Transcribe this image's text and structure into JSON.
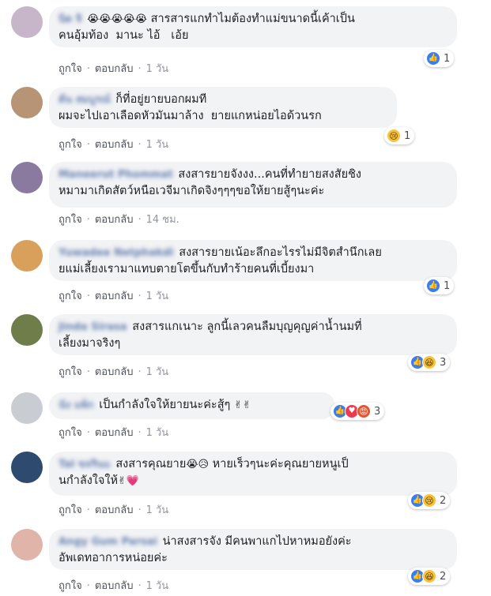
{
  "actions": {
    "like": "ถูกใจ",
    "reply": "ตอบกลับ",
    "sep": "·"
  },
  "comments": [
    {
      "name": "นิด จิ",
      "text1": "สารสารแกทำไมต้องทำแม่ขนาดนี้เค้าเป็น",
      "text2": "คนอุ้มท้อง  มานะ ไอ้   เอ้ย",
      "emoji": "😭😭😭😭😭",
      "time": "1 วัน",
      "reaction_count": "1",
      "avatar_color": "#c7b6c9"
    },
    {
      "name": "ต้น สมบูรณ์",
      "text1": "ก็ที่อยู่ยายบอกผมที",
      "text2": "ผมจะไปเอาเลือดหัวมันมาล้าง  ยายแกหน่อยไอด้วนรก",
      "time": "1 วัน",
      "reaction_count": "1",
      "avatar_color": "#b89477"
    },
    {
      "name": "Maneerut Phommat",
      "text1": "สงสารยายจังงง...คนที่ทำยายสงสัยชิง",
      "text2": "หมามาเกิดสัตว์หนือเวจีมาเกิดจิงๆๆๆขอให้ยายสู้ๆนะค่ะ",
      "time": "14 ชม.",
      "avatar_color": "#8a7aa0"
    },
    {
      "name": "Yuwadee Netphakdi",
      "text1": "สงสารยายเน้อะลึกอะไรรไม่มีจิตสำนึกเลย",
      "text2": "ยแม่เลี้ยงเรามาแทบตายโตขึ้นกับทำร้ายคนที่เบี้ยงมา",
      "time": "1 วัน",
      "reaction_count": "1",
      "avatar_color": "#d9a05c"
    },
    {
      "name": "Jinda Sirasa",
      "text1": "สงสารแกเนาะ ลูกนี้เลวคนลืมบุญคุญค่าน้ำนมที่",
      "text2": "เลี้ยงมาจริงๆ",
      "time": "1 วัน",
      "reaction_count": "3",
      "avatar_color": "#6f7d4a"
    },
    {
      "name": "นัง แพ็ก",
      "text1": "เป็นกำลังใจให้ยายนะค่ะสู้ๆ",
      "emoji": "✌✌",
      "time": "1 วัน",
      "reaction_count": "3",
      "avatar_color": "#c9ccd1"
    },
    {
      "name": "Tal ขจรินแ",
      "text1": "สงสารคุณยาย",
      "text1b": " หายเร็วๆนะค่ะคุณยายหนูเป็",
      "text2": "นกำลังใจให้",
      "emoji": "😭😥",
      "emoji2": "✌💗",
      "time": "1 วัน",
      "reaction_count": "2",
      "avatar_color": "#2e4a6e"
    },
    {
      "name": "Angy Gum Parsai",
      "text1": "น่าสงสารจัง มีคนพาแกไปหาหมอยังค่ะ",
      "text2": "อัพเดทอาการหน่อยค่ะ",
      "time": "1 วัน",
      "reaction_count": "2",
      "avatar_color": "#e0b4a8"
    }
  ]
}
